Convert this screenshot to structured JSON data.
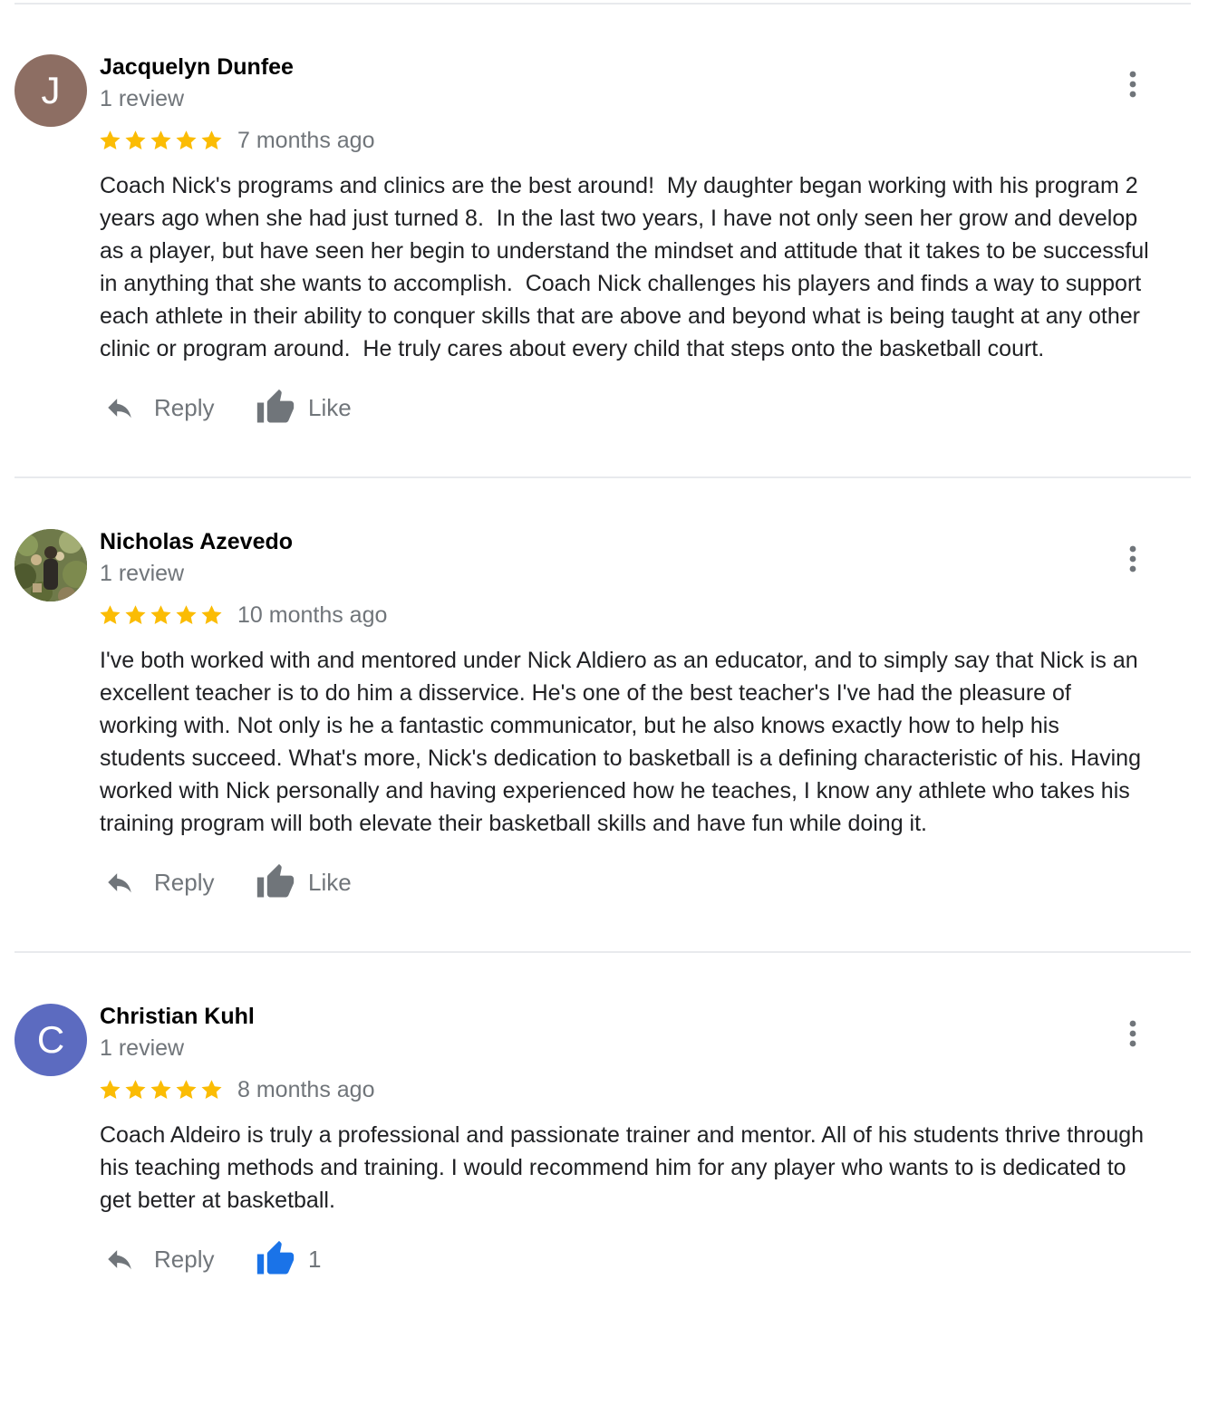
{
  "reviews": [
    {
      "name": "Jacquelyn Dunfee",
      "count": "1 review",
      "rating": 5,
      "date": "7 months ago",
      "avatar": {
        "letter": "J",
        "color": "#8d6e63"
      },
      "lines": [
        "Coach Nick's programs and clinics are the best around!  My daughter began working with his program 2",
        "years ago when she had just turned 8.  In the last two years, I have not only seen her grow and develop",
        "as a player, but have seen her begin to understand the mindset and attitude that it takes to be successful",
        "in anything that she wants to accomplish.  Coach Nick challenges his players and finds a way to support",
        "each athlete in their ability to conquer skills that are above and beyond what is being taught at any other",
        "clinic or program around.  He truly cares about every child that steps onto the basketball court."
      ],
      "reply_label": "Reply",
      "like_label": "Like",
      "liked": false
    },
    {
      "name": "Nicholas Azevedo",
      "count": "1 review",
      "rating": 5,
      "date": "10 months ago",
      "avatar": {
        "letter": "",
        "color": "#5b6b3c"
      },
      "lines": [
        "I've both worked with and mentored under Nick Aldiero as an educator, and to simply say that Nick is an",
        "excellent teacher is to do him a disservice. He's one of the best teacher's I've had the pleasure of",
        "working with. Not only is he a fantastic communicator, but he also knows exactly how to help his",
        "students succeed. What's more, Nick's dedication to basketball is a defining characteristic of his. Having",
        "worked with Nick personally and having experienced how he teaches, I know any athlete who takes his",
        "training program will both elevate their basketball skills and have fun while doing it."
      ],
      "reply_label": "Reply",
      "like_label": "Like",
      "liked": false
    },
    {
      "name": "Christian Kuhl",
      "count": "1 review",
      "rating": 5,
      "date": "8 months ago",
      "avatar": {
        "letter": "C",
        "color": "#5c6bc0"
      },
      "lines": [
        "Coach Aldeiro is truly a professional and passionate trainer and mentor. All of his students thrive through",
        "his teaching methods and training. I would recommend him for any player who wants to is dedicated to",
        "get better at basketball."
      ],
      "reply_label": "Reply",
      "like_label": "1",
      "liked": true
    }
  ],
  "colors": {
    "star": "#fbbc04",
    "icon_gray": "#70757a",
    "like_active": "#1a73e8",
    "divider": "#e8eaed"
  }
}
